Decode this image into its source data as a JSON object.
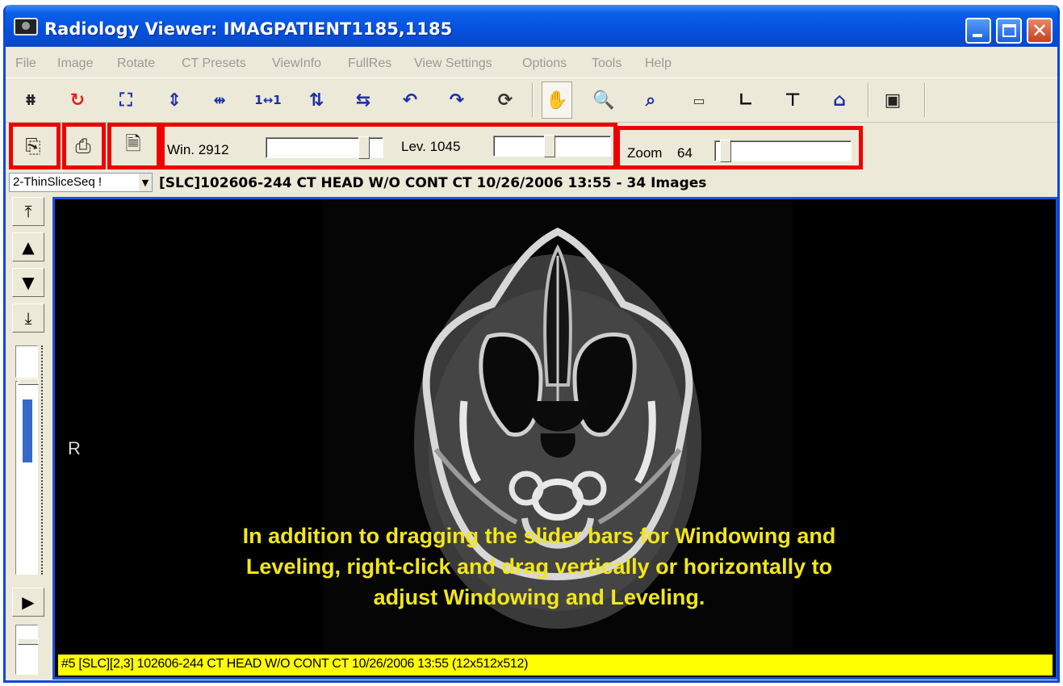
{
  "window": {
    "title": "Radiology Viewer: IMAGPATIENT1185,1185"
  },
  "menu": [
    "File",
    "Image",
    "Rotate",
    "CT Presets",
    "ViewInfo",
    "FullRes",
    "View Settings",
    "Options",
    "Tools",
    "Help"
  ],
  "controls": {
    "win_label": "Win. 2912",
    "lev_label": "Lev. 1045",
    "zoom_label": "Zoom",
    "zoom_value": "64"
  },
  "series": {
    "selected": "2-ThinSliceSeq !",
    "header": "[SLC]102606-244  CT HEAD W/O CONT CT 10/26/2006 13:55  - 34  Images"
  },
  "image": {
    "orientation_label": "R",
    "caption": "In addition to dragging the slider bars for Windowing and Leveling, right-click and drag vertically or horizontally to adjust Windowing and Leveling.",
    "status": "#5 [SLC][2,3] 102606-244  CT HEAD W/O CONT CT 10/26/2006 13:55 (12x512x512)"
  },
  "accent_colors": {
    "highlight_box": "#ee0000",
    "caption": "#f2e61a",
    "status_bg": "#ffff00",
    "frame": "#1e4fe0"
  }
}
